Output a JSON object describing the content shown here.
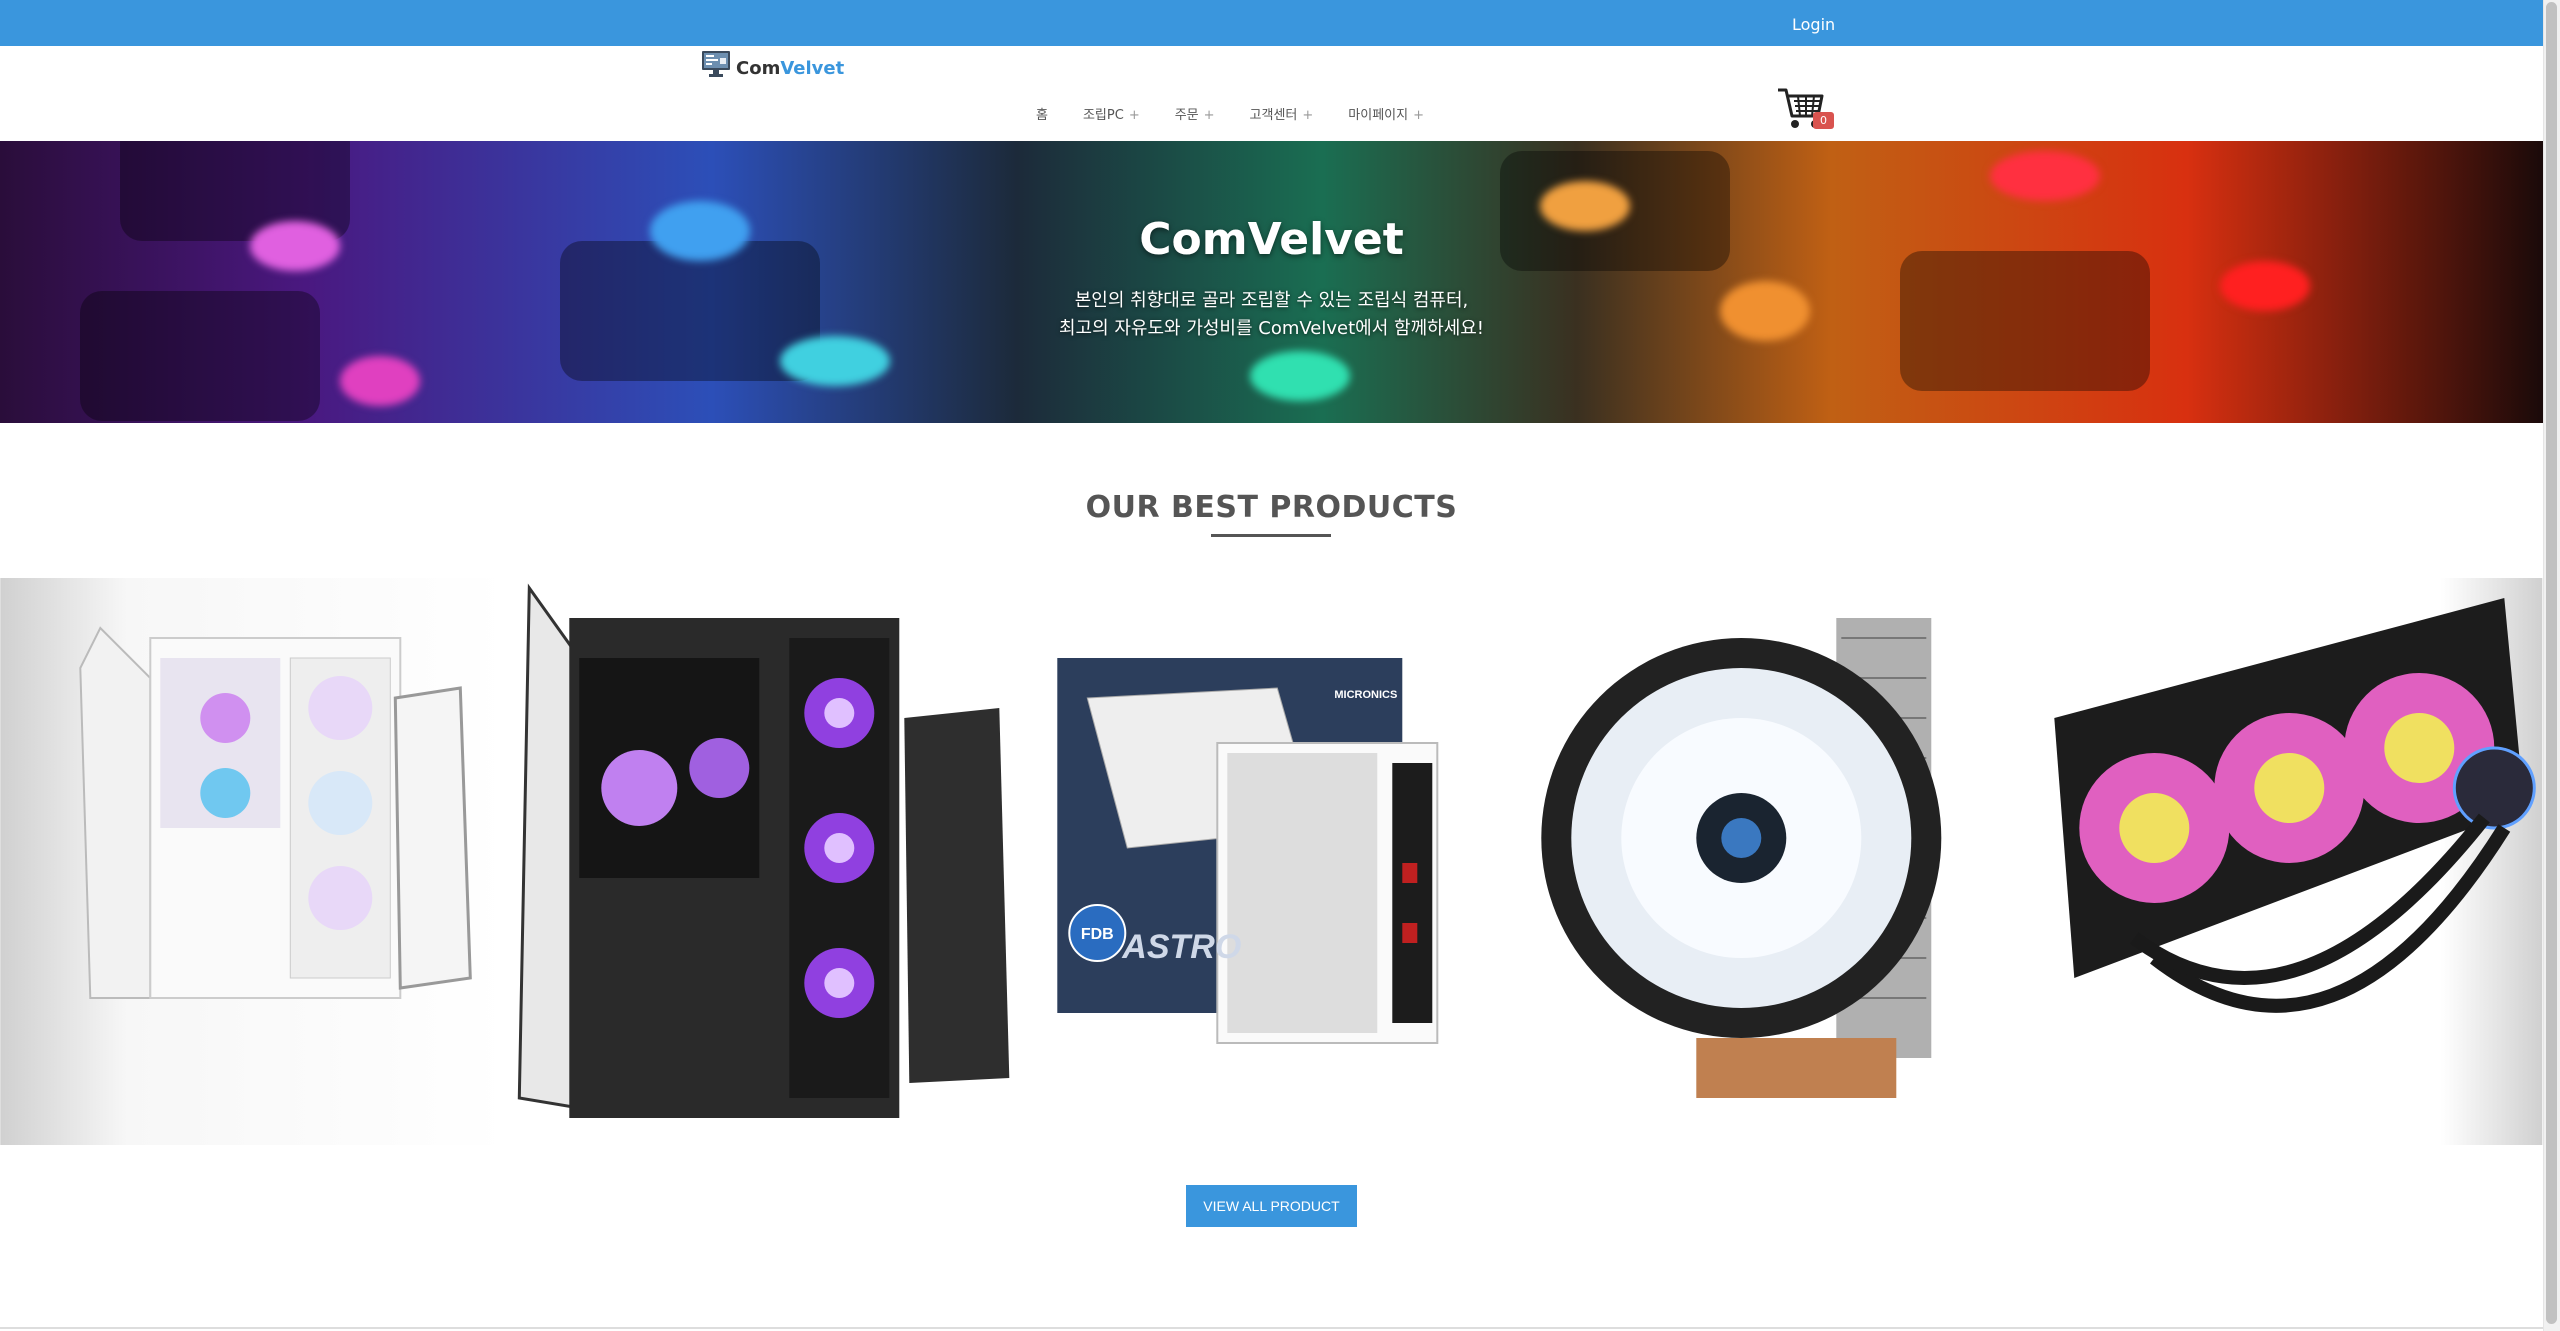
{
  "topbar": {
    "login_label": "Login"
  },
  "logo": {
    "text_primary": "Com",
    "text_accent": "Velvet"
  },
  "nav": {
    "items": [
      {
        "label": "홈",
        "has_plus": false
      },
      {
        "label": "조립PC",
        "has_plus": true
      },
      {
        "label": "주문",
        "has_plus": true
      },
      {
        "label": "고객센터",
        "has_plus": true
      },
      {
        "label": "마이페이지",
        "has_plus": true
      }
    ],
    "plus_symbol": "+"
  },
  "cart": {
    "count": "0",
    "icon": "cart-icon"
  },
  "hero": {
    "title": "ComVelvet",
    "subtitle_line1": "본인의 취향대로 골라 조립할 수 있는 조립식 컴퓨터,",
    "subtitle_line2": "최고의 자유도와 가성비를 ComVelvet에서 함께하세요!"
  },
  "best_products": {
    "title": "OUR BEST PRODUCTS",
    "items": [
      {
        "name": "white-pc-case"
      },
      {
        "name": "black-pc-case"
      },
      {
        "name": "power-supply",
        "box_text": "ASTRO",
        "brand": "MICRONICS",
        "badge": "FDB"
      },
      {
        "name": "cpu-air-cooler"
      },
      {
        "name": "liquid-cooler"
      }
    ],
    "view_all_label": "VIEW ALL PRODUCT"
  },
  "colors": {
    "accent": "#3a96dd",
    "badge": "#d9534f",
    "title": "#555555"
  }
}
